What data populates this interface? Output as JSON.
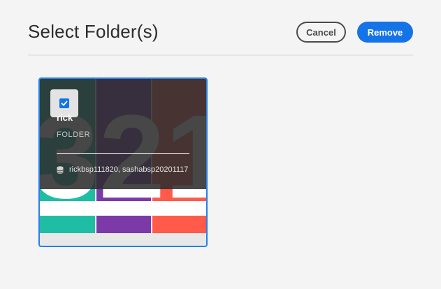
{
  "header": {
    "title": "Select Folder(s)",
    "cancel_label": "Cancel",
    "remove_label": "Remove"
  },
  "card": {
    "name": "rick",
    "type": "FOLDER",
    "meta": "rickbsp111820, sashabsp20201117",
    "selected": true,
    "thumbnail_text": "321"
  },
  "colors": {
    "accent": "#1473e6",
    "teal": "#1fbea4",
    "purple": "#7b3aa8",
    "coral": "#ff5a4a"
  },
  "icons": {
    "checkbox": "checkmark-icon",
    "meta": "database-icon"
  }
}
